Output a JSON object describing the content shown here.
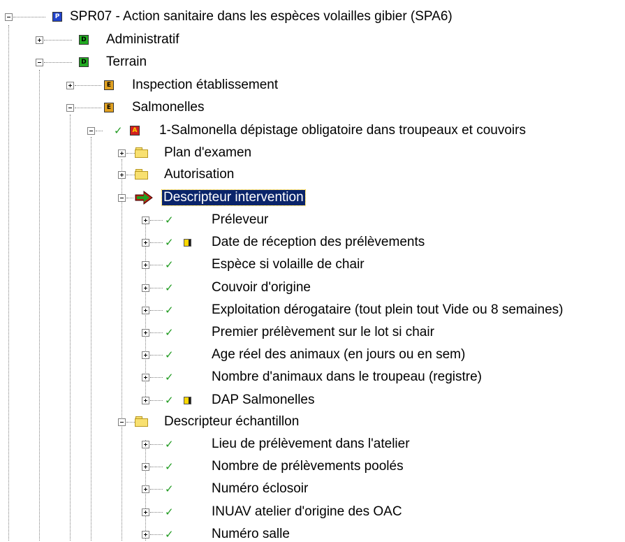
{
  "tree": {
    "root": {
      "badge": "P",
      "label": "SPR07 - Action sanitaire dans les espèces volailles gibier (SPA6)"
    },
    "administratif": {
      "badge": "D",
      "label": "Administratif"
    },
    "terrain": {
      "badge": "D",
      "label": "Terrain"
    },
    "inspection": {
      "badge": "E",
      "label": "Inspection établissement"
    },
    "salmonelles": {
      "badge": "E",
      "label": "Salmonelles"
    },
    "action": {
      "badge": "A",
      "label": "1-Salmonella  dépistage obligatoire  dans troupeaux et couvoirs"
    },
    "plan_examen": {
      "label": "Plan d'examen"
    },
    "autorisation": {
      "label": "Autorisation"
    },
    "descripteur_intervention": {
      "label": "Descripteur intervention"
    },
    "intervention_items": [
      {
        "label": "Préleveur",
        "note": false
      },
      {
        "label": "Date de réception des prélèvements",
        "note": true
      },
      {
        "label": "Espèce si volaille de chair",
        "note": false
      },
      {
        "label": "Couvoir d'origine",
        "note": false
      },
      {
        "label": "Exploitation dérogataire (tout plein tout Vide ou 8 semaines)",
        "note": false
      },
      {
        "label": "Premier prélèvement sur le lot si chair",
        "note": false
      },
      {
        "label": "Age réel des animaux (en jours ou en sem)",
        "note": false
      },
      {
        "label": "Nombre d'animaux dans le troupeau (registre)",
        "note": false
      },
      {
        "label": "DAP Salmonelles",
        "note": true
      }
    ],
    "descripteur_echantillon": {
      "label": "Descripteur échantillon"
    },
    "echantillon_items": [
      {
        "label": "Lieu de prélèvement dans l'atelier"
      },
      {
        "label": "Nombre de prélèvements poolés"
      },
      {
        "label": "Numéro  éclosoir"
      },
      {
        "label": "INUAV atelier d'origine des OAC"
      },
      {
        "label": "Numéro salle"
      }
    ]
  },
  "colors": {
    "selection": "#0a246a",
    "check": "#1f9a1f"
  }
}
